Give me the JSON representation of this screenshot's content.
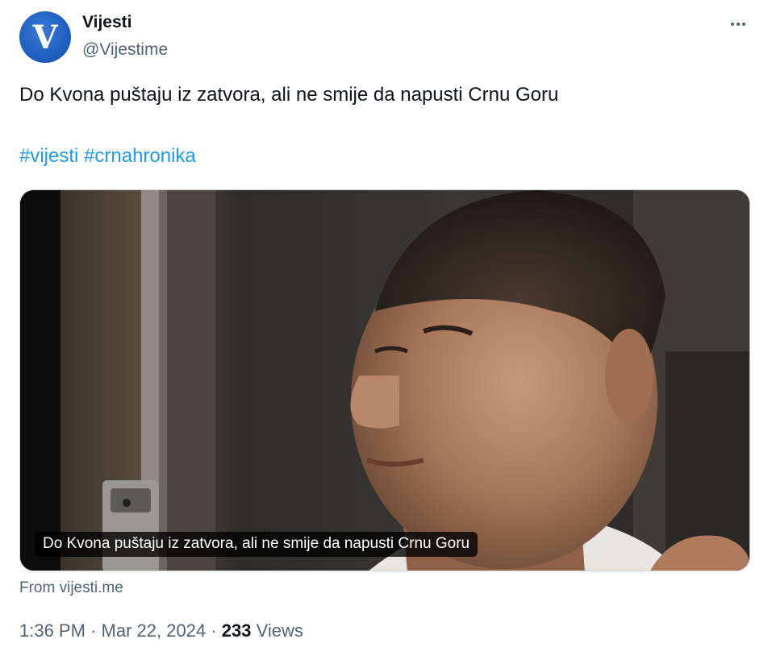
{
  "author": {
    "avatar_letter": "V",
    "display_name": "Vijesti",
    "handle": "@Vijestime"
  },
  "tweet": {
    "text": "Do Kvona puštaju iz zatvora, ali ne smije da napusti Crnu Goru",
    "hashtags": [
      "#vijesti",
      "#crnahronika"
    ]
  },
  "media": {
    "caption": "Do Kvona puštaju iz zatvora, ali ne smije da napusti Crnu Goru",
    "source": "From vijesti.me"
  },
  "meta": {
    "time": "1:36 PM",
    "separator": "·",
    "date": "Mar 22, 2024",
    "views_count": "233",
    "views_label": "Views"
  },
  "colors": {
    "link": "#1d9bf0",
    "secondary_text": "#536471",
    "avatar_blue": "#1f5fbf"
  },
  "icons": {
    "more": "more-horizontal-icon"
  }
}
